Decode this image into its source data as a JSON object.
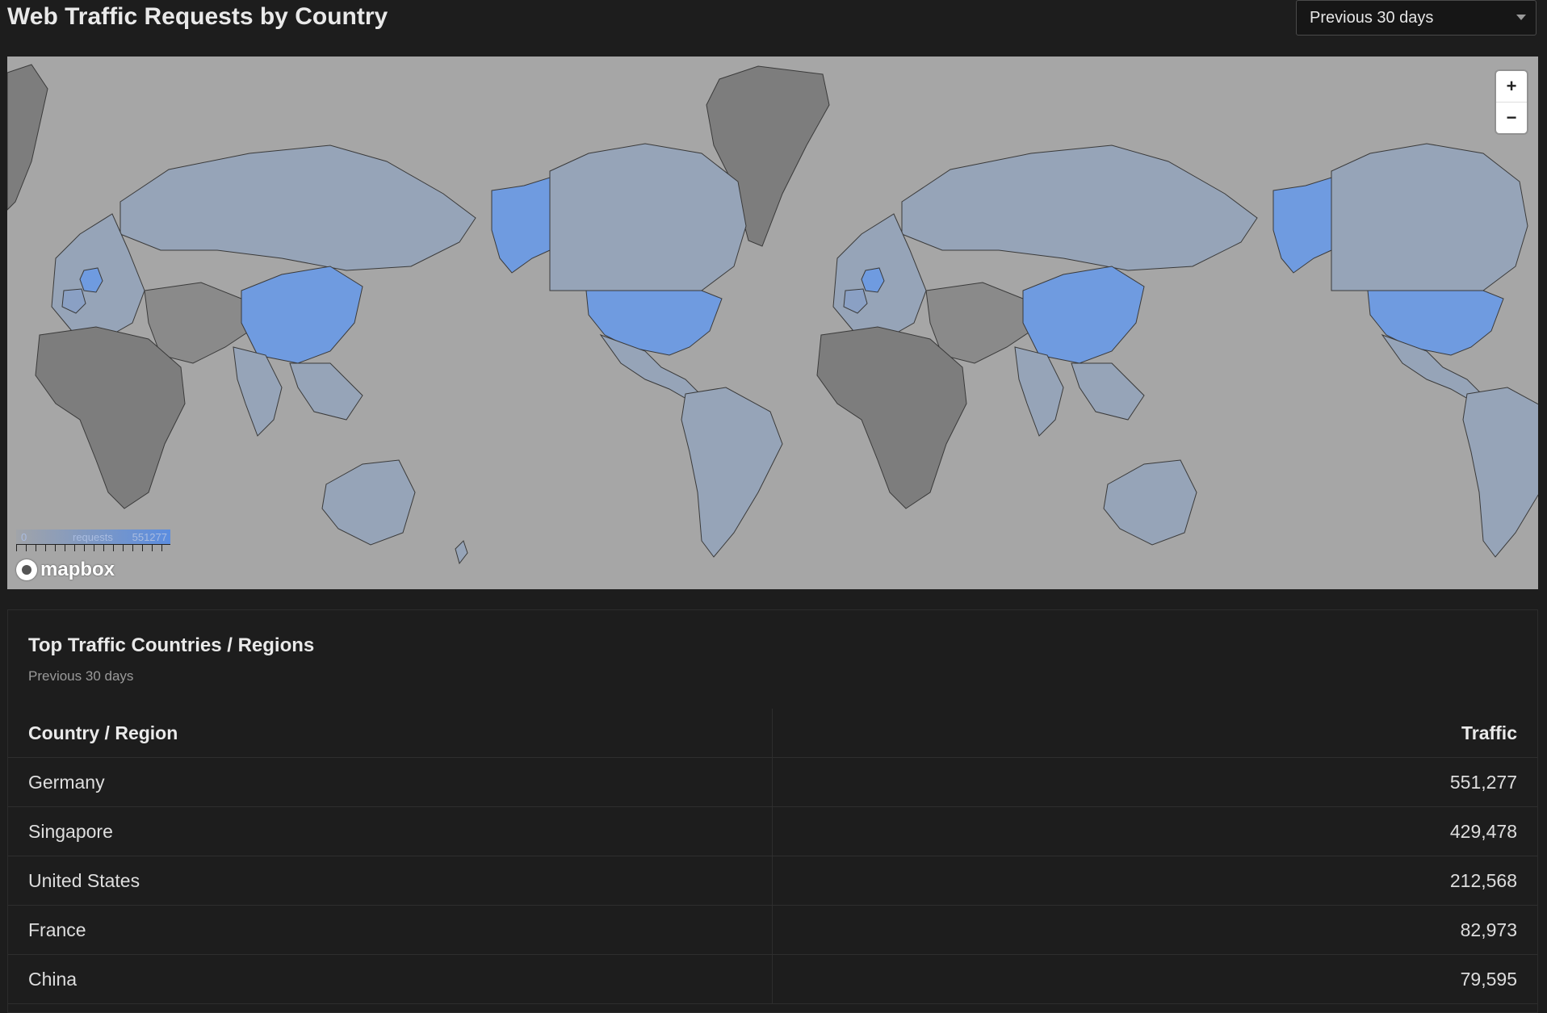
{
  "header": {
    "title": "Web Traffic Requests by Country",
    "range_selected": "Previous 30 days",
    "dropdown_icon": "chevron-down-icon"
  },
  "map": {
    "zoom_in_label": "+",
    "zoom_out_label": "−",
    "legend": {
      "min_label": "0",
      "label": "requests",
      "max_label": "551277"
    },
    "attribution": "mapbox",
    "colors": {
      "ocean": "#a6a6a6",
      "land_with_traffic": "#96a4b8",
      "land_no_data": "#7d7d7d",
      "highlight": "#6f9be0"
    },
    "highlighted_countries": [
      "Germany",
      "United States",
      "China"
    ]
  },
  "panel": {
    "title": "Top Traffic Countries / Regions",
    "subtitle": "Previous 30 days",
    "columns": [
      "Country / Region",
      "Traffic"
    ],
    "rows": [
      {
        "country": "Germany",
        "traffic": "551,277"
      },
      {
        "country": "Singapore",
        "traffic": "429,478"
      },
      {
        "country": "United States",
        "traffic": "212,568"
      },
      {
        "country": "France",
        "traffic": "82,973"
      },
      {
        "country": "China",
        "traffic": "79,595"
      }
    ]
  }
}
